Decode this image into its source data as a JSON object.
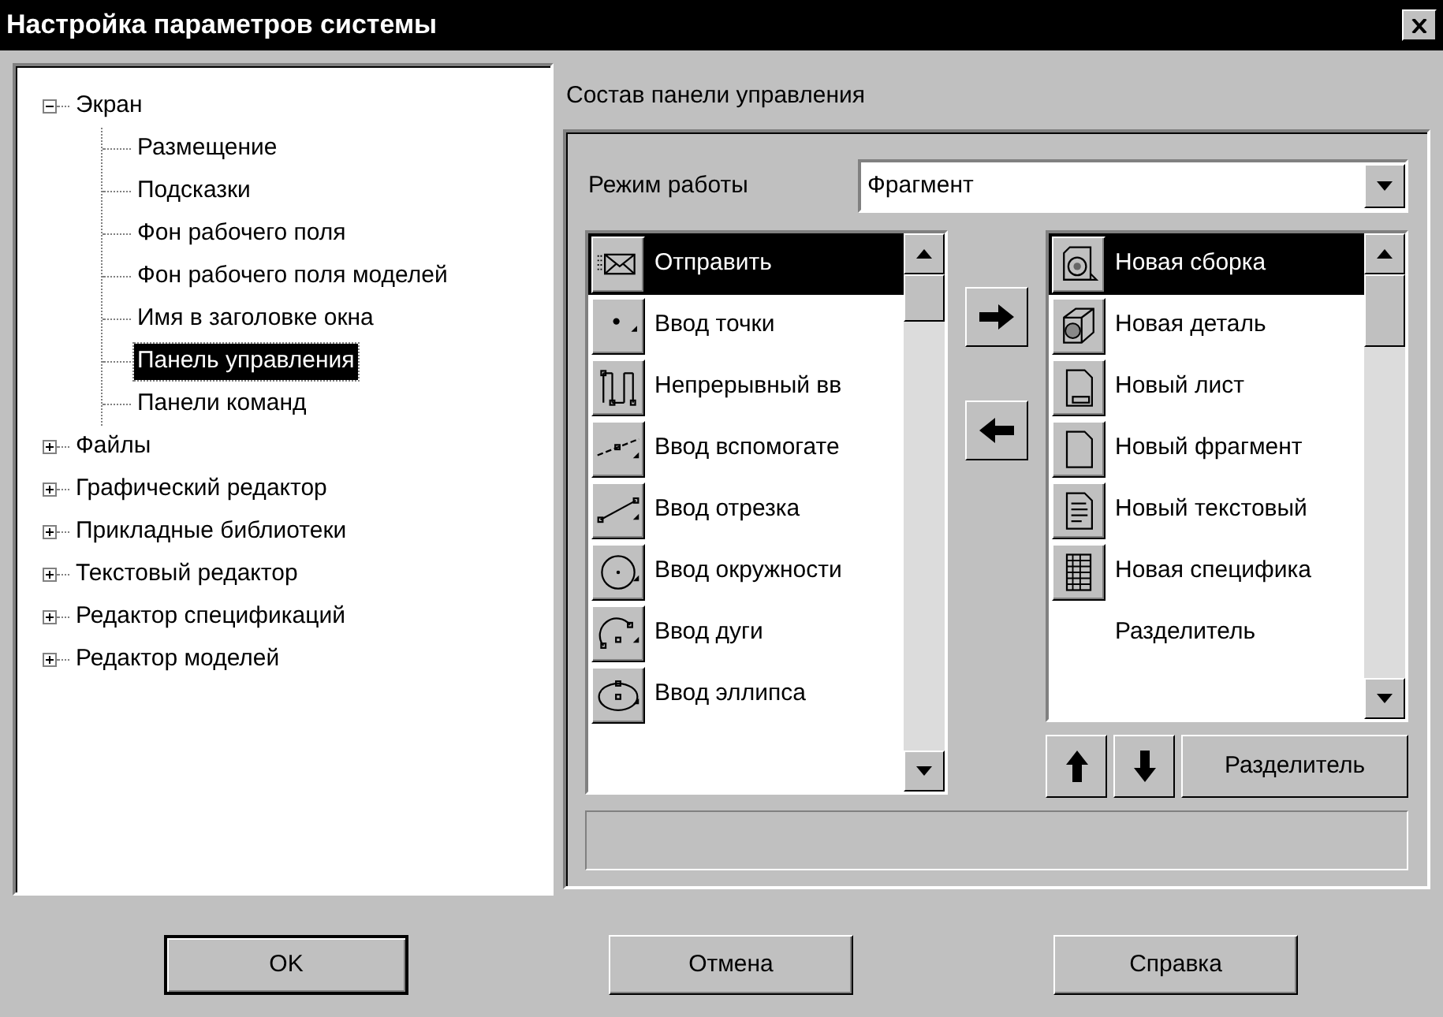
{
  "window": {
    "title": "Настройка параметров системы"
  },
  "tree": [
    {
      "label": "Экран",
      "expanded": true,
      "selected": false,
      "children": [
        {
          "label": "Размещение",
          "selected": false
        },
        {
          "label": "Подсказки",
          "selected": false
        },
        {
          "label": "Фон рабочего поля",
          "selected": false
        },
        {
          "label": "Фон рабочего поля моделей",
          "selected": false
        },
        {
          "label": "Имя в заголовке окна",
          "selected": false
        },
        {
          "label": "Панель управления",
          "selected": true
        },
        {
          "label": "Панели команд",
          "selected": false
        }
      ]
    },
    {
      "label": "Файлы",
      "expanded": false,
      "selected": false
    },
    {
      "label": "Графический редактор",
      "expanded": false,
      "selected": false
    },
    {
      "label": "Прикладные библиотеки",
      "expanded": false,
      "selected": false
    },
    {
      "label": "Текстовый редактор",
      "expanded": false,
      "selected": false
    },
    {
      "label": "Редактор спецификаций",
      "expanded": false,
      "selected": false
    },
    {
      "label": "Редактор моделей",
      "expanded": false,
      "selected": false
    }
  ],
  "panel": {
    "caption": "Состав панели управления",
    "mode": {
      "label": "Режим работы",
      "value": "Фрагмент"
    },
    "available": [
      {
        "label": "Отправить",
        "selected": true
      },
      {
        "label": "Ввод точки",
        "selected": false
      },
      {
        "label": "Непрерывный вв",
        "selected": false
      },
      {
        "label": "Ввод вспомогате",
        "selected": false
      },
      {
        "label": "Ввод отрезка",
        "selected": false
      },
      {
        "label": "Ввод окружности",
        "selected": false
      },
      {
        "label": "Ввод дуги",
        "selected": false
      },
      {
        "label": "Ввод эллипса",
        "selected": false
      }
    ],
    "chosen": [
      {
        "label": "Новая сборка",
        "selected": true,
        "kind": "command"
      },
      {
        "label": "Новая деталь",
        "selected": false,
        "kind": "command"
      },
      {
        "label": "Новый лист",
        "selected": false,
        "kind": "command"
      },
      {
        "label": "Новый фрагмент",
        "selected": false,
        "kind": "command"
      },
      {
        "label": "Новый текстовый",
        "selected": false,
        "kind": "command"
      },
      {
        "label": "Новая специфика",
        "selected": false,
        "kind": "command"
      },
      {
        "label": "Разделитель",
        "selected": false,
        "kind": "separator"
      }
    ],
    "separator_button": {
      "label": "Разделитель"
    }
  },
  "buttons": [
    {
      "label": "OK",
      "default": true
    },
    {
      "label": "Отмена",
      "default": false
    },
    {
      "label": "Справка",
      "default": false
    }
  ]
}
